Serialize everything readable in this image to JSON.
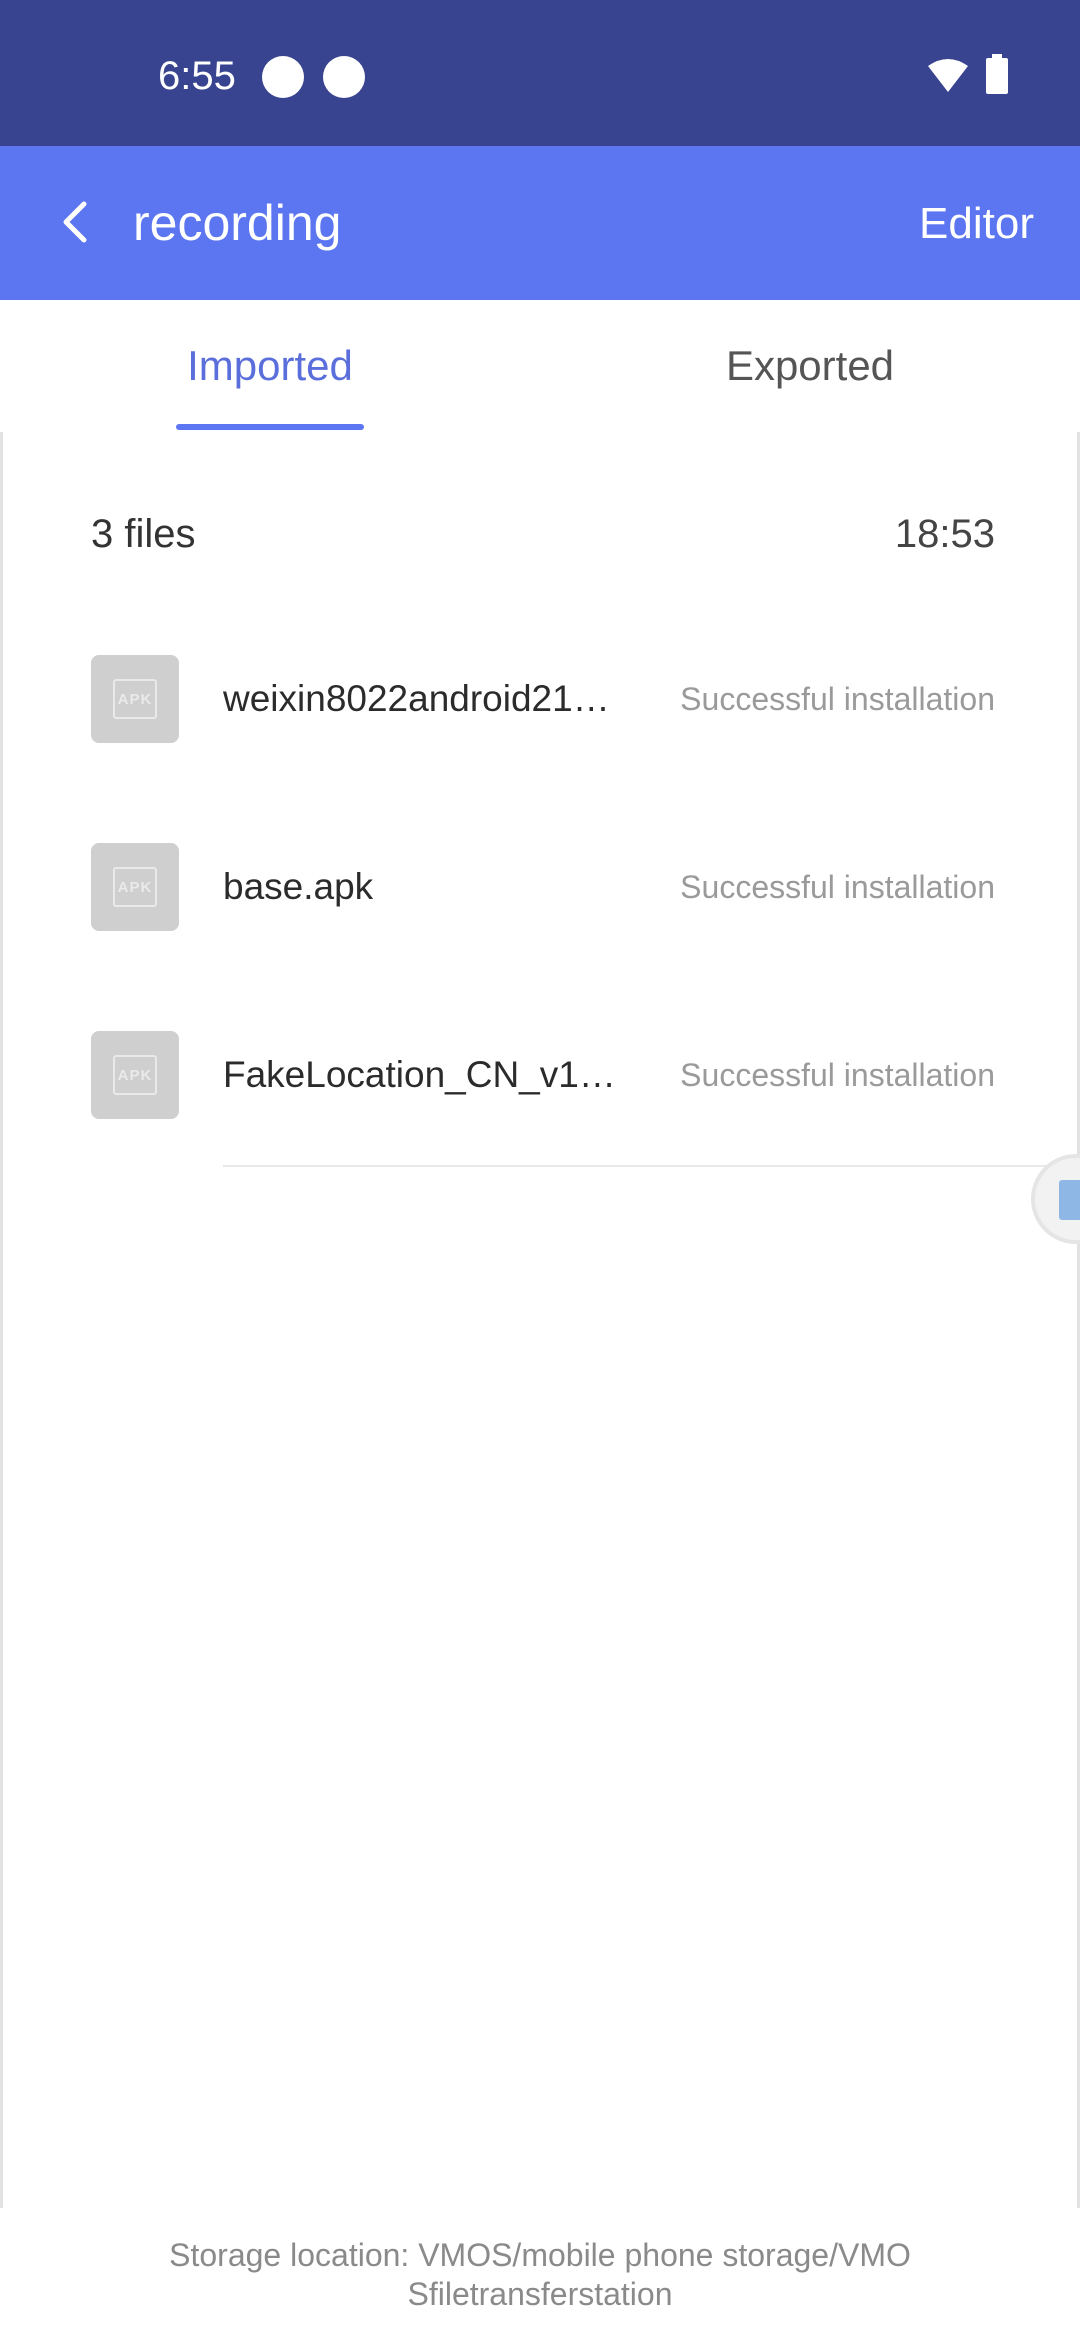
{
  "status_bar": {
    "time": "6:55"
  },
  "app_bar": {
    "title": "recording",
    "editor_label": "Editor"
  },
  "tabs": [
    {
      "label": "Imported",
      "active": true
    },
    {
      "label": "Exported",
      "active": false
    }
  ],
  "group": {
    "count": "3 files",
    "time": "18:53"
  },
  "files": [
    {
      "icon_text": "APK",
      "name": "weixin8022android214…",
      "status": "Successful installation"
    },
    {
      "icon_text": "APK",
      "name": "base.apk",
      "status": "Successful installation"
    },
    {
      "icon_text": "APK",
      "name": "FakeLocation_CN_v1.3…",
      "status": "Successful installation"
    }
  ],
  "footer": {
    "line1": "Storage location: VMOS/mobile phone storage/VMO",
    "line2": "Sfiletransferstation"
  },
  "colors": {
    "status_bar": "#38448f",
    "app_bar": "#5b76f0",
    "tab_active": "#5b6fdc"
  }
}
